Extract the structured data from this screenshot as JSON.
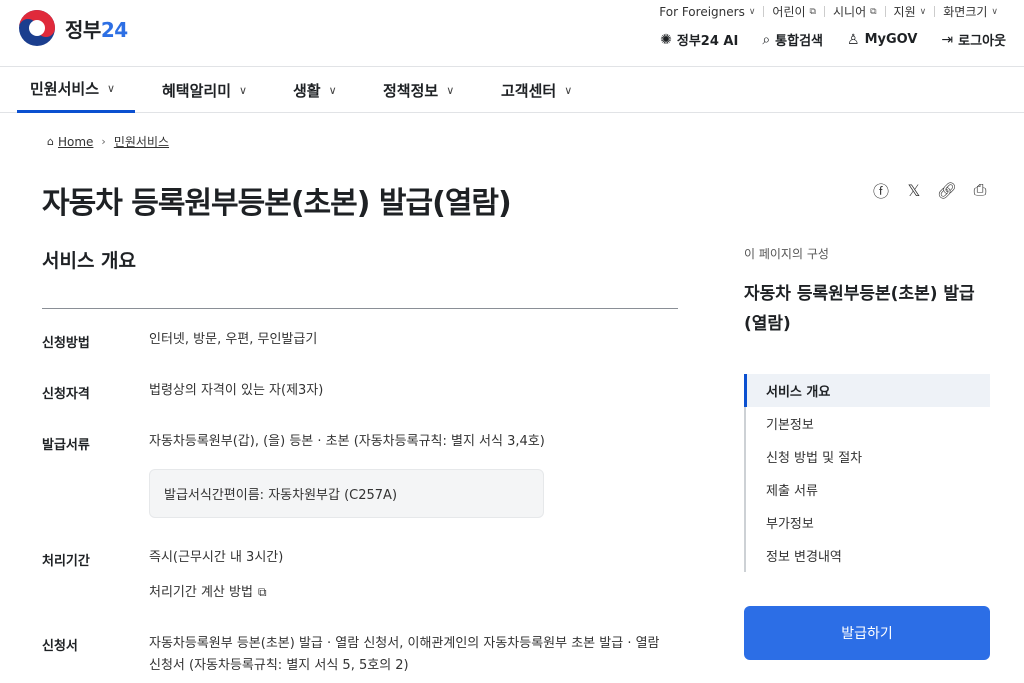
{
  "logo": {
    "text": "정부",
    "num": "24"
  },
  "util_top": [
    {
      "label": "For Foreigners",
      "chevron": true
    },
    {
      "label": "어린이",
      "ext": true
    },
    {
      "label": "시니어",
      "ext": true
    },
    {
      "label": "지원",
      "chevron": true
    },
    {
      "label": "화면크기",
      "chevron": true
    }
  ],
  "util_main": {
    "ai": "정부24 AI",
    "search": "통합검색",
    "mygov": "MyGOV",
    "logout": "로그아웃"
  },
  "gnb": [
    "민원서비스",
    "혜택알리미",
    "생활",
    "정책정보",
    "고객센터"
  ],
  "breadcrumb": {
    "home": "Home",
    "current": "민원서비스"
  },
  "page_title": "자동차 등록원부등본(초본) 발급(열람)",
  "section_title": "서비스 개요",
  "rows": {
    "method_label": "신청방법",
    "method_value": "인터넷, 방문, 우편, 무인발급기",
    "qual_label": "신청자격",
    "qual_value": "법령상의 자격이 있는 자(제3자)",
    "docs_label": "발급서류",
    "docs_value": "자동차등록원부(갑), (을) 등본 · 초본 (자동차등록규칙: 별지 서식 3,4호)",
    "docs_note": "발급서식간편이름: 자동차원부갑 (C257A)",
    "time_label": "처리기간",
    "time_value": "즉시(근무시간 내 3시간)",
    "time_calc": "처리기간 계산 방법",
    "form_label": "신청서",
    "form_value_1": "자동차등록원부 등본(초본) 발급 · 열람 신청서, 이해관계인의 자동차등록원부 초본 발급 · 열람",
    "form_value_2": "신청서 (자동차등록규칙: 별지 서식 5, 5호의 2)"
  },
  "toc": {
    "label": "이 페이지의 구성",
    "title": "자동차 등록원부등본(초본) 발급(열람)",
    "items": [
      "서비스 개요",
      "기본정보",
      "신청 방법 및 절차",
      "제출 서류",
      "부가정보",
      "정보 변경내역"
    ]
  },
  "issue_button": "발급하기",
  "colors": {
    "primary": "#2c6ee6",
    "active_nav": "#0b50d0"
  }
}
